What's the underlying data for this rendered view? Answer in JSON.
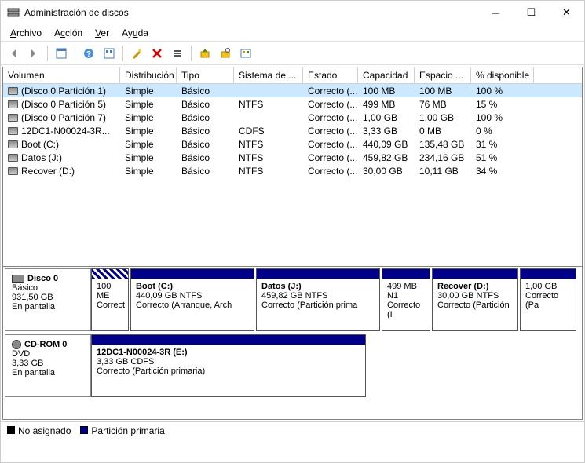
{
  "window": {
    "title": "Administración de discos"
  },
  "menu": {
    "archivo": "Archivo",
    "accion": "Acción",
    "ver": "Ver",
    "ayuda": "Ayuda"
  },
  "columns": {
    "volumen": "Volumen",
    "distribucion": "Distribución",
    "tipo": "Tipo",
    "sistema": "Sistema de ...",
    "estado": "Estado",
    "capacidad": "Capacidad",
    "espacio": "Espacio ...",
    "pct": "% disponible"
  },
  "volumes": [
    {
      "name": "(Disco 0 Partición 1)",
      "dist": "Simple",
      "tipo": "Básico",
      "fs": "",
      "estado": "Correcto (...",
      "cap": "100 MB",
      "free": "100 MB",
      "pct": "100 %",
      "selected": true
    },
    {
      "name": "(Disco 0 Partición 5)",
      "dist": "Simple",
      "tipo": "Básico",
      "fs": "NTFS",
      "estado": "Correcto (...",
      "cap": "499 MB",
      "free": "76 MB",
      "pct": "15 %"
    },
    {
      "name": "(Disco 0 Partición 7)",
      "dist": "Simple",
      "tipo": "Básico",
      "fs": "",
      "estado": "Correcto (...",
      "cap": "1,00 GB",
      "free": "1,00 GB",
      "pct": "100 %"
    },
    {
      "name": "12DC1-N00024-3R...",
      "dist": "Simple",
      "tipo": "Básico",
      "fs": "CDFS",
      "estado": "Correcto (...",
      "cap": "3,33 GB",
      "free": "0 MB",
      "pct": "0 %"
    },
    {
      "name": "Boot (C:)",
      "dist": "Simple",
      "tipo": "Básico",
      "fs": "NTFS",
      "estado": "Correcto (...",
      "cap": "440,09 GB",
      "free": "135,48 GB",
      "pct": "31 %"
    },
    {
      "name": "Datos (J:)",
      "dist": "Simple",
      "tipo": "Básico",
      "fs": "NTFS",
      "estado": "Correcto (...",
      "cap": "459,82 GB",
      "free": "234,16 GB",
      "pct": "51 %"
    },
    {
      "name": "Recover (D:)",
      "dist": "Simple",
      "tipo": "Básico",
      "fs": "NTFS",
      "estado": "Correcto (...",
      "cap": "30,00 GB",
      "free": "10,11 GB",
      "pct": "34 %"
    }
  ],
  "disks": {
    "d0": {
      "name": "Disco 0",
      "type": "Básico",
      "size": "931,50 GB",
      "status": "En pantalla"
    },
    "cd0": {
      "name": "CD-ROM 0",
      "type": "DVD",
      "size": "3,33 GB",
      "status": "En pantalla"
    }
  },
  "parts": {
    "p0": {
      "line1": "100 ME",
      "line2": "Correct"
    },
    "p1": {
      "name": "Boot  (C:)",
      "size": "440,09 GB NTFS",
      "status": "Correcto (Arranque, Arch"
    },
    "p2": {
      "name": "Datos  (J:)",
      "size": "459,82 GB NTFS",
      "status": "Correcto (Partición prima"
    },
    "p3": {
      "line1": "499 MB N1",
      "line2": "Correcto (I"
    },
    "p4": {
      "name": "Recover  (D:)",
      "size": "30,00 GB NTFS",
      "status": "Correcto (Partición"
    },
    "p5": {
      "line1": "1,00 GB",
      "line2": "Correcto (Pa"
    },
    "cd": {
      "name": "12DC1-N00024-3R  (E:)",
      "size": "3,33 GB CDFS",
      "status": "Correcto (Partición primaria)"
    }
  },
  "legend": {
    "unalloc": "No asignado",
    "primary": "Partición primaria"
  }
}
